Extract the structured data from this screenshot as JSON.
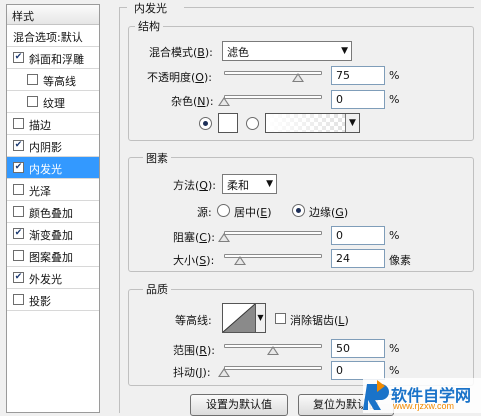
{
  "sidebar": {
    "header": "样式",
    "items": [
      {
        "label": "混合选项:默认",
        "checkbox": false,
        "checked": false,
        "selected": false
      },
      {
        "label": "斜面和浮雕",
        "checkbox": true,
        "checked": true,
        "selected": false
      },
      {
        "label": "等高线",
        "checkbox": true,
        "checked": false,
        "selected": false
      },
      {
        "label": "纹理",
        "checkbox": true,
        "checked": false,
        "selected": false
      },
      {
        "label": "描边",
        "checkbox": true,
        "checked": false,
        "selected": false
      },
      {
        "label": "内阴影",
        "checkbox": true,
        "checked": true,
        "selected": false
      },
      {
        "label": "内发光",
        "checkbox": true,
        "checked": true,
        "selected": true
      },
      {
        "label": "光泽",
        "checkbox": true,
        "checked": false,
        "selected": false
      },
      {
        "label": "颜色叠加",
        "checkbox": true,
        "checked": false,
        "selected": false
      },
      {
        "label": "渐变叠加",
        "checkbox": true,
        "checked": true,
        "selected": false
      },
      {
        "label": "图案叠加",
        "checkbox": true,
        "checked": false,
        "selected": false
      },
      {
        "label": "外发光",
        "checkbox": true,
        "checked": true,
        "selected": false
      },
      {
        "label": "投影",
        "checkbox": true,
        "checked": false,
        "selected": false
      }
    ]
  },
  "panel": {
    "title": "内发光",
    "structure": {
      "legend": "结构",
      "blend_mode_label": "混合模式(",
      "blend_mode_key": "B",
      "blend_mode_value": "滤色",
      "opacity_label": "不透明度(",
      "opacity_key": "O",
      "opacity_value": "75",
      "opacity_level": 75,
      "noise_label": "杂色(",
      "noise_key": "N",
      "noise_value": "0",
      "noise_level": 0,
      "unit": "%"
    },
    "elements": {
      "legend": "图素",
      "method_label": "方法(",
      "method_key": "Q",
      "method_value": "柔和",
      "source_label": "源:",
      "center_label": "居中(",
      "center_key": "E",
      "edge_label": "边缘(",
      "edge_key": "G",
      "choke_label": "阻塞(",
      "choke_key": "C",
      "choke_value": "0",
      "choke_level": 0,
      "size_label": "大小(",
      "size_key": "S",
      "size_value": "24",
      "size_unit": "像素",
      "unit": "%"
    },
    "quality": {
      "legend": "品质",
      "contour_label": "等高线:",
      "antialias_label": "消除锯齿(",
      "antialias_key": "L",
      "range_label": "范围(",
      "range_key": "R",
      "range_value": "50",
      "range_level": 50,
      "jitter_label": "抖动(",
      "jitter_key": "J",
      "jitter_value": "0",
      "jitter_level": 0,
      "unit": "%"
    },
    "buttons": {
      "make_default": "设置为默认值",
      "reset_default": "复位为默认值"
    }
  },
  "watermark": {
    "text": "软件自学网",
    "url": "www.rjzxw.com",
    "colors": {
      "blue": "#1a73c9",
      "orange": "#f28a00"
    }
  },
  "colors": {
    "selection": "#3399ff",
    "glow_color": "#ffffff"
  }
}
